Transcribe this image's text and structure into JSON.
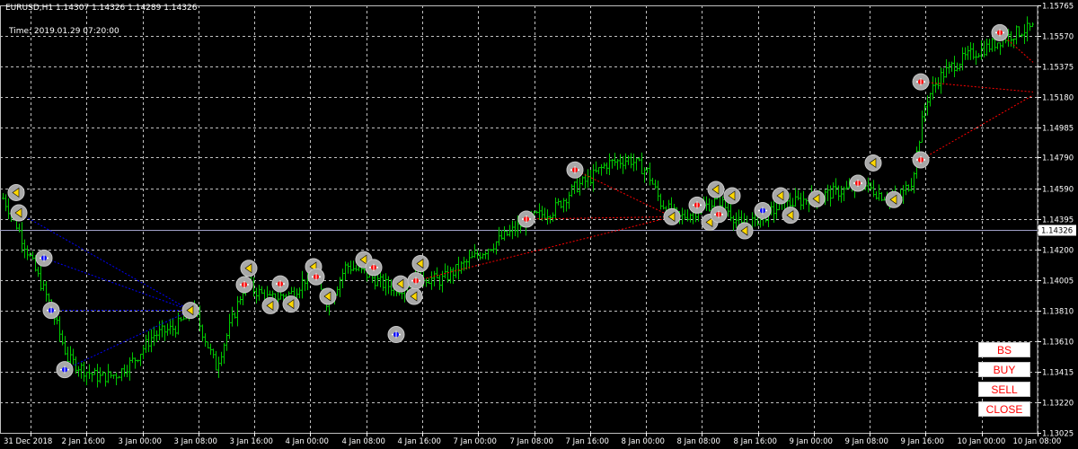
{
  "header": {
    "symbol_line": "EURUSD,H1  1.14307 1.14326 1.14289 1.14326",
    "time_line": "Time: 2019.01.29 07:20:00"
  },
  "buttons": [
    {
      "label": "BS"
    },
    {
      "label": "BUY"
    },
    {
      "label": "SELL"
    },
    {
      "label": "CLOSE"
    }
  ],
  "colors": {
    "background": "#000000",
    "grid": "#c0c0c0",
    "candle": "#00c800",
    "bid_line": "#a0a0c8",
    "buy_marker": "#0000ff",
    "sell_marker": "#ff0000",
    "close_marker": "#ffd700",
    "marker_ring": "#a8a8a8"
  },
  "chart_data": {
    "type": "ohlc",
    "symbol": "EURUSD",
    "timeframe": "H1",
    "last_price": "1.14326",
    "y_ticks": [
      "1.15765",
      "1.15570",
      "1.15375",
      "1.15180",
      "1.14985",
      "1.14790",
      "1.14590",
      "1.14395",
      "1.14200",
      "1.14005",
      "1.13810",
      "1.13610",
      "1.13415",
      "1.13220",
      "1.13025"
    ],
    "x_ticks": [
      "31 Dec 2018",
      "2 Jan 16:00",
      "3 Jan 00:00",
      "3 Jan 08:00",
      "3 Jan 16:00",
      "4 Jan 00:00",
      "4 Jan 08:00",
      "4 Jan 16:00",
      "7 Jan 00:00",
      "7 Jan 08:00",
      "7 Jan 16:00",
      "8 Jan 00:00",
      "8 Jan 08:00",
      "8 Jan 16:00",
      "9 Jan 00:00",
      "9 Jan 08:00",
      "9 Jan 16:00",
      "10 Jan 00:00",
      "10 Jan 08:00"
    ],
    "ylim": [
      1.13025,
      1.15765
    ],
    "grid": true,
    "path_anchors": [
      [
        0,
        1.1456
      ],
      [
        15,
        1.144
      ],
      [
        40,
        1.1405
      ],
      [
        55,
        1.1385
      ],
      [
        75,
        1.135
      ],
      [
        95,
        1.1342
      ],
      [
        110,
        1.1338
      ],
      [
        130,
        1.134
      ],
      [
        150,
        1.135
      ],
      [
        170,
        1.1365
      ],
      [
        195,
        1.137
      ],
      [
        215,
        1.1382
      ],
      [
        240,
        1.1345
      ],
      [
        255,
        1.137
      ],
      [
        272,
        1.1398
      ],
      [
        300,
        1.1388
      ],
      [
        325,
        1.1392
      ],
      [
        345,
        1.1405
      ],
      [
        365,
        1.1385
      ],
      [
        385,
        1.141
      ],
      [
        405,
        1.1405
      ],
      [
        425,
        1.1398
      ],
      [
        445,
        1.1395
      ],
      [
        465,
        1.1403
      ],
      [
        490,
        1.14
      ],
      [
        515,
        1.141
      ],
      [
        540,
        1.142
      ],
      [
        565,
        1.143
      ],
      [
        590,
        1.144
      ],
      [
        615,
        1.1445
      ],
      [
        640,
        1.146
      ],
      [
        655,
        1.1465
      ],
      [
        675,
        1.1475
      ],
      [
        700,
        1.1478
      ],
      [
        720,
        1.147
      ],
      [
        735,
        1.145
      ],
      [
        755,
        1.144
      ],
      [
        775,
        1.1445
      ],
      [
        800,
        1.1452
      ],
      [
        825,
        1.1435
      ],
      [
        845,
        1.144
      ],
      [
        870,
        1.1448
      ],
      [
        895,
        1.1452
      ],
      [
        915,
        1.1455
      ],
      [
        940,
        1.1458
      ],
      [
        960,
        1.1462
      ],
      [
        980,
        1.1455
      ],
      [
        1000,
        1.1452
      ],
      [
        1015,
        1.1465
      ],
      [
        1030,
        1.1515
      ],
      [
        1045,
        1.153
      ],
      [
        1060,
        1.1538
      ],
      [
        1080,
        1.1545
      ],
      [
        1100,
        1.155
      ],
      [
        1115,
        1.1555
      ],
      [
        1135,
        1.156
      ],
      [
        1150,
        1.1562
      ]
    ],
    "trades": [
      {
        "x": 18,
        "price": 1.14565,
        "type": "close"
      },
      {
        "x": 21,
        "price": 1.14435,
        "type": "close"
      },
      {
        "x": 49,
        "price": 1.14145,
        "type": "buy"
      },
      {
        "x": 57,
        "price": 1.1381,
        "type": "buy"
      },
      {
        "x": 72,
        "price": 1.1343,
        "type": "buy"
      },
      {
        "x": 212,
        "price": 1.1381,
        "type": "close"
      },
      {
        "x": 272,
        "price": 1.13975,
        "type": "sell"
      },
      {
        "x": 277,
        "price": 1.1408,
        "type": "close"
      },
      {
        "x": 301,
        "price": 1.1384,
        "type": "close"
      },
      {
        "x": 312,
        "price": 1.1398,
        "type": "sell"
      },
      {
        "x": 324,
        "price": 1.1385,
        "type": "close"
      },
      {
        "x": 349,
        "price": 1.1409,
        "type": "close"
      },
      {
        "x": 352,
        "price": 1.14025,
        "type": "sell"
      },
      {
        "x": 365,
        "price": 1.139,
        "type": "close"
      },
      {
        "x": 405,
        "price": 1.14135,
        "type": "close"
      },
      {
        "x": 416,
        "price": 1.14085,
        "type": "sell"
      },
      {
        "x": 441,
        "price": 1.13655,
        "type": "buy"
      },
      {
        "x": 446,
        "price": 1.1398,
        "type": "close"
      },
      {
        "x": 461,
        "price": 1.139,
        "type": "close"
      },
      {
        "x": 463,
        "price": 1.14,
        "type": "sell"
      },
      {
        "x": 468,
        "price": 1.1411,
        "type": "close"
      },
      {
        "x": 586,
        "price": 1.14395,
        "type": "sell"
      },
      {
        "x": 640,
        "price": 1.1471,
        "type": "sell"
      },
      {
        "x": 748,
        "price": 1.1441,
        "type": "close"
      },
      {
        "x": 776,
        "price": 1.14485,
        "type": "sell"
      },
      {
        "x": 790,
        "price": 1.14375,
        "type": "close"
      },
      {
        "x": 797,
        "price": 1.14585,
        "type": "close"
      },
      {
        "x": 800,
        "price": 1.14425,
        "type": "sell"
      },
      {
        "x": 815,
        "price": 1.14545,
        "type": "close"
      },
      {
        "x": 829,
        "price": 1.1432,
        "type": "close"
      },
      {
        "x": 849,
        "price": 1.1445,
        "type": "buy"
      },
      {
        "x": 869,
        "price": 1.14545,
        "type": "close"
      },
      {
        "x": 880,
        "price": 1.1442,
        "type": "close"
      },
      {
        "x": 909,
        "price": 1.14525,
        "type": "close"
      },
      {
        "x": 955,
        "price": 1.14625,
        "type": "sell"
      },
      {
        "x": 972,
        "price": 1.14755,
        "type": "close"
      },
      {
        "x": 995,
        "price": 1.1452,
        "type": "close"
      },
      {
        "x": 1025,
        "price": 1.14775,
        "type": "sell"
      },
      {
        "x": 1025,
        "price": 1.15275,
        "type": "sell"
      },
      {
        "x": 1113,
        "price": 1.1559,
        "type": "sell"
      }
    ],
    "links": [
      {
        "from": [
          21,
          1.14435
        ],
        "to": [
          212,
          1.1381
        ],
        "color": "#0000ff"
      },
      {
        "from": [
          49,
          1.14145
        ],
        "to": [
          212,
          1.1381
        ],
        "color": "#0000ff"
      },
      {
        "from": [
          57,
          1.1381
        ],
        "to": [
          212,
          1.1381
        ],
        "color": "#0000ff"
      },
      {
        "from": [
          72,
          1.1343
        ],
        "to": [
          212,
          1.1381
        ],
        "color": "#0000ff"
      },
      {
        "from": [
          463,
          1.14
        ],
        "to": [
          748,
          1.1441
        ],
        "color": "#ff0000"
      },
      {
        "from": [
          640,
          1.1471
        ],
        "to": [
          748,
          1.1441
        ],
        "color": "#ff0000"
      },
      {
        "from": [
          586,
          1.14395
        ],
        "to": [
          748,
          1.1441
        ],
        "color": "#ff0000"
      },
      {
        "from": [
          1025,
          1.14775
        ],
        "to": [
          1150,
          1.1519
        ],
        "color": "#ff0000"
      },
      {
        "from": [
          1025,
          1.15275
        ],
        "to": [
          1150,
          1.1521
        ],
        "color": "#ff0000"
      },
      {
        "from": [
          1113,
          1.1559
        ],
        "to": [
          1150,
          1.154
        ],
        "color": "#ff0000"
      }
    ]
  }
}
